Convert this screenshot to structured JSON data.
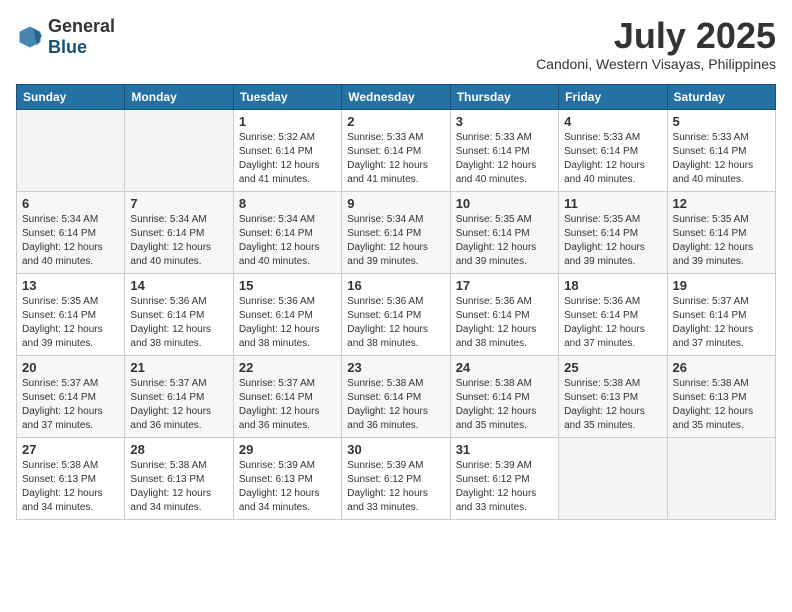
{
  "header": {
    "logo_general": "General",
    "logo_blue": "Blue",
    "month": "July 2025",
    "location": "Candoni, Western Visayas, Philippines"
  },
  "days_of_week": [
    "Sunday",
    "Monday",
    "Tuesday",
    "Wednesday",
    "Thursday",
    "Friday",
    "Saturday"
  ],
  "weeks": [
    [
      {
        "day": "",
        "sunrise": "",
        "sunset": "",
        "daylight": ""
      },
      {
        "day": "",
        "sunrise": "",
        "sunset": "",
        "daylight": ""
      },
      {
        "day": "1",
        "sunrise": "Sunrise: 5:32 AM",
        "sunset": "Sunset: 6:14 PM",
        "daylight": "Daylight: 12 hours and 41 minutes."
      },
      {
        "day": "2",
        "sunrise": "Sunrise: 5:33 AM",
        "sunset": "Sunset: 6:14 PM",
        "daylight": "Daylight: 12 hours and 41 minutes."
      },
      {
        "day": "3",
        "sunrise": "Sunrise: 5:33 AM",
        "sunset": "Sunset: 6:14 PM",
        "daylight": "Daylight: 12 hours and 40 minutes."
      },
      {
        "day": "4",
        "sunrise": "Sunrise: 5:33 AM",
        "sunset": "Sunset: 6:14 PM",
        "daylight": "Daylight: 12 hours and 40 minutes."
      },
      {
        "day": "5",
        "sunrise": "Sunrise: 5:33 AM",
        "sunset": "Sunset: 6:14 PM",
        "daylight": "Daylight: 12 hours and 40 minutes."
      }
    ],
    [
      {
        "day": "6",
        "sunrise": "Sunrise: 5:34 AM",
        "sunset": "Sunset: 6:14 PM",
        "daylight": "Daylight: 12 hours and 40 minutes."
      },
      {
        "day": "7",
        "sunrise": "Sunrise: 5:34 AM",
        "sunset": "Sunset: 6:14 PM",
        "daylight": "Daylight: 12 hours and 40 minutes."
      },
      {
        "day": "8",
        "sunrise": "Sunrise: 5:34 AM",
        "sunset": "Sunset: 6:14 PM",
        "daylight": "Daylight: 12 hours and 40 minutes."
      },
      {
        "day": "9",
        "sunrise": "Sunrise: 5:34 AM",
        "sunset": "Sunset: 6:14 PM",
        "daylight": "Daylight: 12 hours and 39 minutes."
      },
      {
        "day": "10",
        "sunrise": "Sunrise: 5:35 AM",
        "sunset": "Sunset: 6:14 PM",
        "daylight": "Daylight: 12 hours and 39 minutes."
      },
      {
        "day": "11",
        "sunrise": "Sunrise: 5:35 AM",
        "sunset": "Sunset: 6:14 PM",
        "daylight": "Daylight: 12 hours and 39 minutes."
      },
      {
        "day": "12",
        "sunrise": "Sunrise: 5:35 AM",
        "sunset": "Sunset: 6:14 PM",
        "daylight": "Daylight: 12 hours and 39 minutes."
      }
    ],
    [
      {
        "day": "13",
        "sunrise": "Sunrise: 5:35 AM",
        "sunset": "Sunset: 6:14 PM",
        "daylight": "Daylight: 12 hours and 39 minutes."
      },
      {
        "day": "14",
        "sunrise": "Sunrise: 5:36 AM",
        "sunset": "Sunset: 6:14 PM",
        "daylight": "Daylight: 12 hours and 38 minutes."
      },
      {
        "day": "15",
        "sunrise": "Sunrise: 5:36 AM",
        "sunset": "Sunset: 6:14 PM",
        "daylight": "Daylight: 12 hours and 38 minutes."
      },
      {
        "day": "16",
        "sunrise": "Sunrise: 5:36 AM",
        "sunset": "Sunset: 6:14 PM",
        "daylight": "Daylight: 12 hours and 38 minutes."
      },
      {
        "day": "17",
        "sunrise": "Sunrise: 5:36 AM",
        "sunset": "Sunset: 6:14 PM",
        "daylight": "Daylight: 12 hours and 38 minutes."
      },
      {
        "day": "18",
        "sunrise": "Sunrise: 5:36 AM",
        "sunset": "Sunset: 6:14 PM",
        "daylight": "Daylight: 12 hours and 37 minutes."
      },
      {
        "day": "19",
        "sunrise": "Sunrise: 5:37 AM",
        "sunset": "Sunset: 6:14 PM",
        "daylight": "Daylight: 12 hours and 37 minutes."
      }
    ],
    [
      {
        "day": "20",
        "sunrise": "Sunrise: 5:37 AM",
        "sunset": "Sunset: 6:14 PM",
        "daylight": "Daylight: 12 hours and 37 minutes."
      },
      {
        "day": "21",
        "sunrise": "Sunrise: 5:37 AM",
        "sunset": "Sunset: 6:14 PM",
        "daylight": "Daylight: 12 hours and 36 minutes."
      },
      {
        "day": "22",
        "sunrise": "Sunrise: 5:37 AM",
        "sunset": "Sunset: 6:14 PM",
        "daylight": "Daylight: 12 hours and 36 minutes."
      },
      {
        "day": "23",
        "sunrise": "Sunrise: 5:38 AM",
        "sunset": "Sunset: 6:14 PM",
        "daylight": "Daylight: 12 hours and 36 minutes."
      },
      {
        "day": "24",
        "sunrise": "Sunrise: 5:38 AM",
        "sunset": "Sunset: 6:14 PM",
        "daylight": "Daylight: 12 hours and 35 minutes."
      },
      {
        "day": "25",
        "sunrise": "Sunrise: 5:38 AM",
        "sunset": "Sunset: 6:13 PM",
        "daylight": "Daylight: 12 hours and 35 minutes."
      },
      {
        "day": "26",
        "sunrise": "Sunrise: 5:38 AM",
        "sunset": "Sunset: 6:13 PM",
        "daylight": "Daylight: 12 hours and 35 minutes."
      }
    ],
    [
      {
        "day": "27",
        "sunrise": "Sunrise: 5:38 AM",
        "sunset": "Sunset: 6:13 PM",
        "daylight": "Daylight: 12 hours and 34 minutes."
      },
      {
        "day": "28",
        "sunrise": "Sunrise: 5:38 AM",
        "sunset": "Sunset: 6:13 PM",
        "daylight": "Daylight: 12 hours and 34 minutes."
      },
      {
        "day": "29",
        "sunrise": "Sunrise: 5:39 AM",
        "sunset": "Sunset: 6:13 PM",
        "daylight": "Daylight: 12 hours and 34 minutes."
      },
      {
        "day": "30",
        "sunrise": "Sunrise: 5:39 AM",
        "sunset": "Sunset: 6:12 PM",
        "daylight": "Daylight: 12 hours and 33 minutes."
      },
      {
        "day": "31",
        "sunrise": "Sunrise: 5:39 AM",
        "sunset": "Sunset: 6:12 PM",
        "daylight": "Daylight: 12 hours and 33 minutes."
      },
      {
        "day": "",
        "sunrise": "",
        "sunset": "",
        "daylight": ""
      },
      {
        "day": "",
        "sunrise": "",
        "sunset": "",
        "daylight": ""
      }
    ]
  ]
}
